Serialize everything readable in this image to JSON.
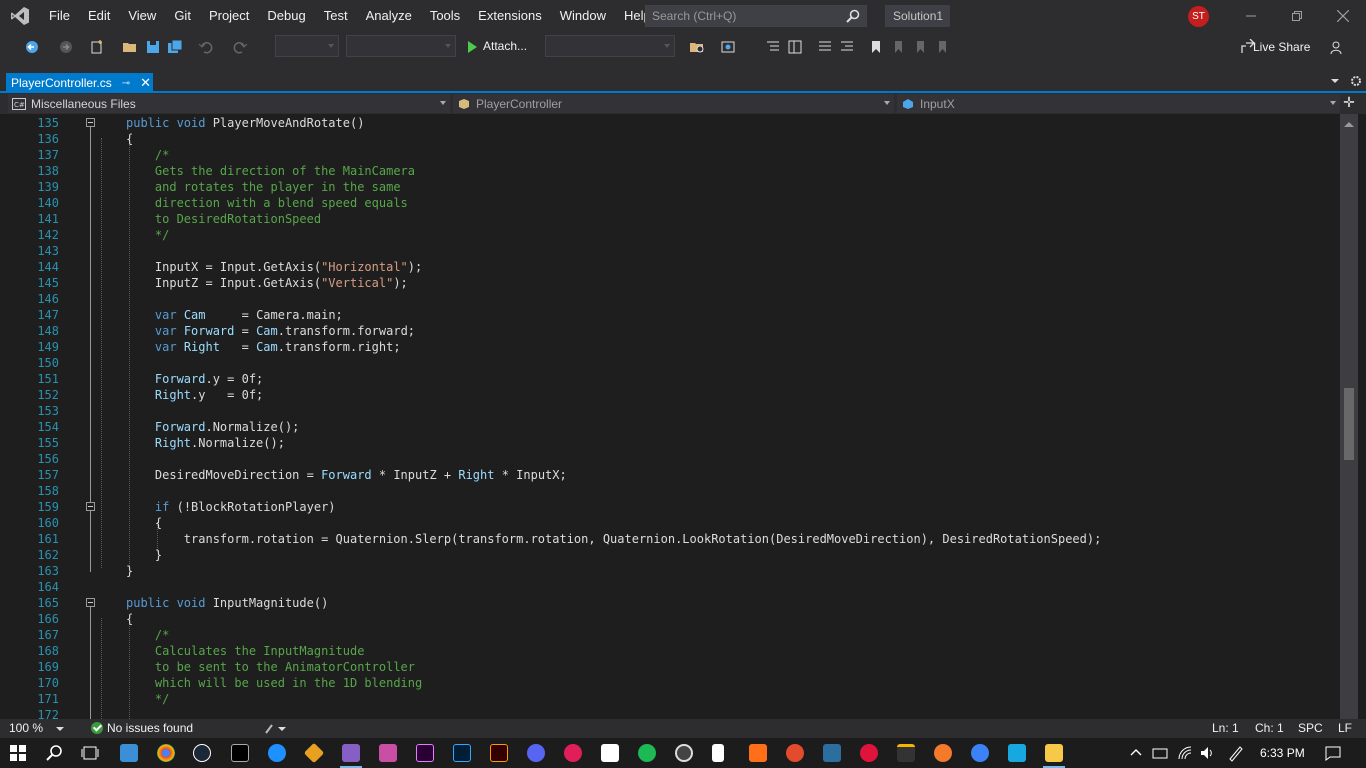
{
  "menu": {
    "items": [
      "File",
      "Edit",
      "View",
      "Git",
      "Project",
      "Debug",
      "Test",
      "Analyze",
      "Tools",
      "Extensions",
      "Window",
      "Help"
    ],
    "search_placeholder": "Search (Ctrl+Q)",
    "solution": "Solution1",
    "user_initials": "ST"
  },
  "toolbar": {
    "attach_label": "Attach...",
    "live_share": "Live Share"
  },
  "tab": {
    "filename": "PlayerController.cs"
  },
  "navbar": {
    "project": "Miscellaneous Files",
    "class": "PlayerController",
    "member": "InputX"
  },
  "editor": {
    "lines": [
      {
        "n": "135",
        "code": [
          [
            "kw",
            "public "
          ],
          [
            "kw",
            "void "
          ],
          [
            "fld",
            "PlayerMoveAndRotate()"
          ]
        ]
      },
      {
        "n": "136",
        "code": [
          [
            "fld",
            "{"
          ]
        ]
      },
      {
        "n": "137",
        "code": [
          [
            "fld",
            "    "
          ],
          [
            "cmt",
            "/*"
          ]
        ]
      },
      {
        "n": "138",
        "code": [
          [
            "fld",
            "    "
          ],
          [
            "cmt",
            "Gets the direction of the MainCamera"
          ]
        ]
      },
      {
        "n": "139",
        "code": [
          [
            "fld",
            "    "
          ],
          [
            "cmt",
            "and rotates the player in the same"
          ]
        ]
      },
      {
        "n": "140",
        "code": [
          [
            "fld",
            "    "
          ],
          [
            "cmt",
            "direction with a blend speed equals"
          ]
        ]
      },
      {
        "n": "141",
        "code": [
          [
            "fld",
            "    "
          ],
          [
            "cmt",
            "to DesiredRotationSpeed"
          ]
        ]
      },
      {
        "n": "142",
        "code": [
          [
            "fld",
            "    "
          ],
          [
            "cmt",
            "*/"
          ]
        ]
      },
      {
        "n": "143",
        "code": []
      },
      {
        "n": "144",
        "code": [
          [
            "fld",
            "    InputX = Input.GetAxis("
          ],
          [
            "str",
            "\"Horizontal\""
          ],
          [
            "fld",
            ");"
          ]
        ]
      },
      {
        "n": "145",
        "code": [
          [
            "fld",
            "    InputZ = Input.GetAxis("
          ],
          [
            "str",
            "\"Vertical\""
          ],
          [
            "fld",
            ");"
          ]
        ]
      },
      {
        "n": "146",
        "code": []
      },
      {
        "n": "147",
        "code": [
          [
            "fld",
            "    "
          ],
          [
            "kw",
            "var "
          ],
          [
            "ident",
            "Cam"
          ],
          [
            "fld",
            "     = Camera.main;"
          ]
        ]
      },
      {
        "n": "148",
        "code": [
          [
            "fld",
            "    "
          ],
          [
            "kw",
            "var "
          ],
          [
            "ident",
            "Forward"
          ],
          [
            "fld",
            " = "
          ],
          [
            "ident",
            "Cam"
          ],
          [
            "fld",
            ".transform.forward;"
          ]
        ]
      },
      {
        "n": "149",
        "code": [
          [
            "fld",
            "    "
          ],
          [
            "kw",
            "var "
          ],
          [
            "ident",
            "Right"
          ],
          [
            "fld",
            "   = "
          ],
          [
            "ident",
            "Cam"
          ],
          [
            "fld",
            ".transform.right;"
          ]
        ]
      },
      {
        "n": "150",
        "code": []
      },
      {
        "n": "151",
        "code": [
          [
            "fld",
            "    "
          ],
          [
            "ident",
            "Forward"
          ],
          [
            "fld",
            ".y = 0f;"
          ]
        ]
      },
      {
        "n": "152",
        "code": [
          [
            "fld",
            "    "
          ],
          [
            "ident",
            "Right"
          ],
          [
            "fld",
            ".y   = 0f;"
          ]
        ]
      },
      {
        "n": "153",
        "code": []
      },
      {
        "n": "154",
        "code": [
          [
            "fld",
            "    "
          ],
          [
            "ident",
            "Forward"
          ],
          [
            "fld",
            ".Normalize();"
          ]
        ]
      },
      {
        "n": "155",
        "code": [
          [
            "fld",
            "    "
          ],
          [
            "ident",
            "Right"
          ],
          [
            "fld",
            ".Normalize();"
          ]
        ]
      },
      {
        "n": "156",
        "code": []
      },
      {
        "n": "157",
        "code": [
          [
            "fld",
            "    DesiredMoveDirection = "
          ],
          [
            "ident",
            "Forward"
          ],
          [
            "fld",
            " * InputZ + "
          ],
          [
            "ident",
            "Right"
          ],
          [
            "fld",
            " * InputX;"
          ]
        ]
      },
      {
        "n": "158",
        "code": []
      },
      {
        "n": "159",
        "code": [
          [
            "fld",
            "    "
          ],
          [
            "kw",
            "if "
          ],
          [
            "fld",
            "(!BlockRotationPlayer)"
          ]
        ]
      },
      {
        "n": "160",
        "code": [
          [
            "fld",
            "    {"
          ]
        ]
      },
      {
        "n": "161",
        "code": [
          [
            "fld",
            "        transform.rotation = Quaternion.Slerp(transform.rotation, Quaternion.LookRotation(DesiredMoveDirection), DesiredRotationSpeed);"
          ]
        ]
      },
      {
        "n": "162",
        "code": [
          [
            "fld",
            "    }"
          ]
        ]
      },
      {
        "n": "163",
        "code": [
          [
            "fld",
            "}"
          ]
        ]
      },
      {
        "n": "164",
        "code": []
      },
      {
        "n": "165",
        "code": [
          [
            "kw",
            "public "
          ],
          [
            "kw",
            "void "
          ],
          [
            "fld",
            "InputMagnitude()"
          ]
        ]
      },
      {
        "n": "166",
        "code": [
          [
            "fld",
            "{"
          ]
        ]
      },
      {
        "n": "167",
        "code": [
          [
            "fld",
            "    "
          ],
          [
            "cmt",
            "/*"
          ]
        ]
      },
      {
        "n": "168",
        "code": [
          [
            "fld",
            "    "
          ],
          [
            "cmt",
            "Calculates the InputMagnitude"
          ]
        ]
      },
      {
        "n": "169",
        "code": [
          [
            "fld",
            "    "
          ],
          [
            "cmt",
            "to be sent to the AnimatorController"
          ]
        ]
      },
      {
        "n": "170",
        "code": [
          [
            "fld",
            "    "
          ],
          [
            "cmt",
            "which will be used in the 1D blending"
          ]
        ]
      },
      {
        "n": "171",
        "code": [
          [
            "fld",
            "    "
          ],
          [
            "cmt",
            "*/"
          ]
        ]
      },
      {
        "n": "172",
        "code": []
      }
    ]
  },
  "status": {
    "zoom": "100 %",
    "issues": "No issues found",
    "line": "Ln: 1",
    "col": "Ch: 1",
    "mode": "SPC",
    "eol": "LF"
  },
  "taskbar": {
    "clock": "6:33 PM"
  }
}
